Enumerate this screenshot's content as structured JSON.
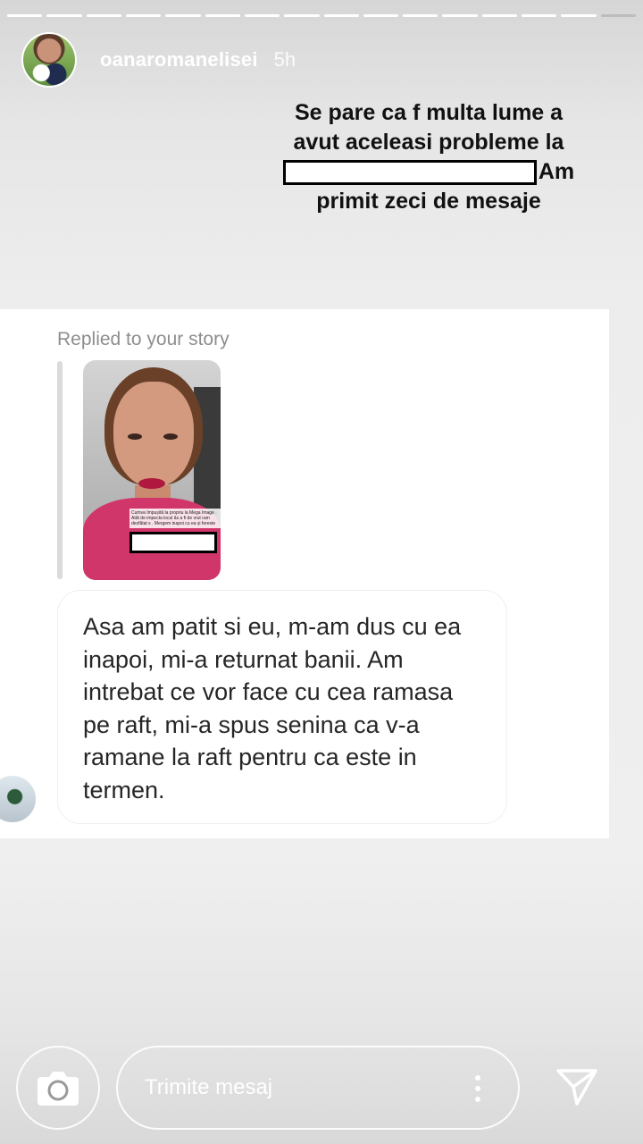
{
  "story": {
    "segments_total": 16,
    "segments_done": 15,
    "username": "oanaromanelisei",
    "time": "5h",
    "caption_line1": "Se pare ca f multa lume a",
    "caption_line2": "avut aceleasi probleme la",
    "caption_line3_end": "Am",
    "caption_line4": "primit zeci de mesaje"
  },
  "dm": {
    "replied_label": "Replied to your story",
    "thumbnail_text": "Cumva împușită la propriu la Mega Image . Atât de impecta locul ăs a fi de vrut ram dezfătat s . Mergem inapoi cu ea și fereste",
    "message": "Asa am patit si eu, m-am dus cu ea inapoi, mi-a returnat banii. Am intrebat ce vor face cu cea ramasa pe raft, mi-a spus senina ca v-a ramane la raft pentru ca este in termen."
  },
  "composer": {
    "placeholder": "Trimite mesaj"
  },
  "icons": {
    "camera": "camera-icon",
    "more": "more-vertical-icon",
    "send": "send-icon"
  },
  "colors": {
    "white": "#ffffff",
    "text_dark": "#262626",
    "muted": "#8e8e8e"
  }
}
